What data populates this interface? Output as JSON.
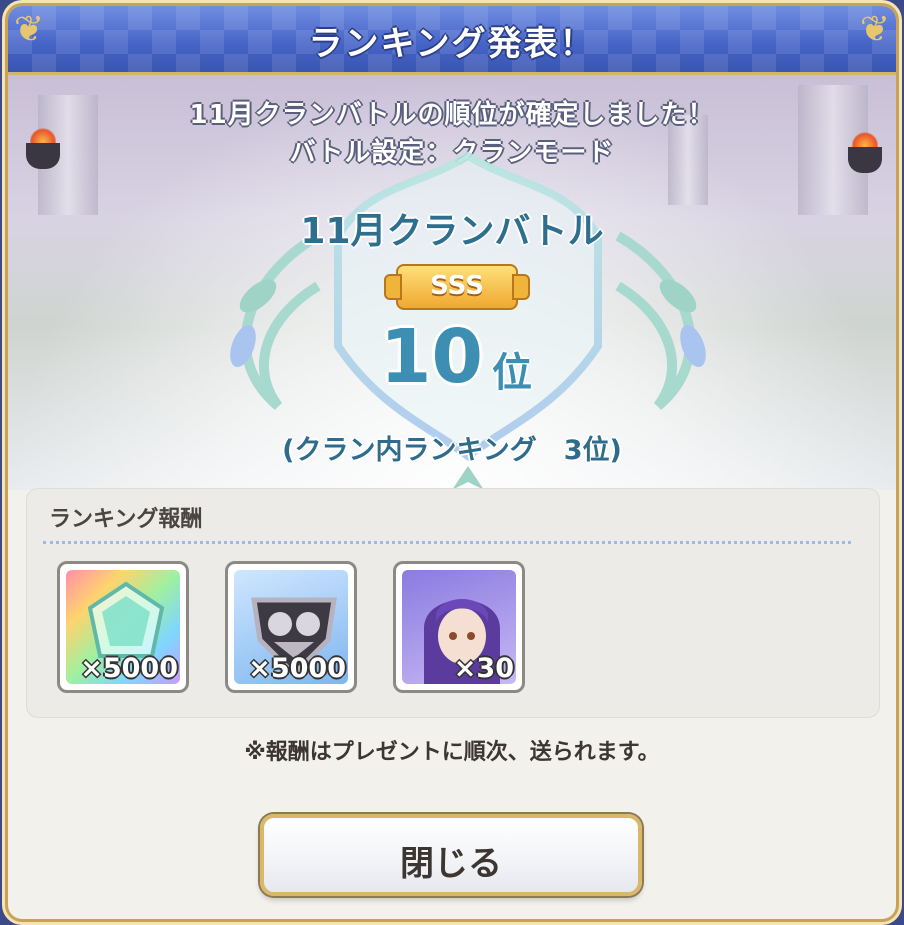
{
  "dialog": {
    "title": "ランキング発表！",
    "announcement_line1": "11月クランバトルの順位が確定しました！",
    "announcement_line2": "バトル設定：クランモード"
  },
  "result": {
    "battle_name": "11月クランバトル",
    "rank_grade": "SSS",
    "rank_number": "10",
    "rank_suffix": "位",
    "clan_internal_rank": "(クラン内ランキング　3位)"
  },
  "rewards": {
    "heading": "ランキング報酬",
    "items": [
      {
        "icon": "rainbow-jewel-icon",
        "quantity": "×5000"
      },
      {
        "icon": "clan-coin-icon",
        "quantity": "×5000"
      },
      {
        "icon": "character-memory-piece-icon",
        "quantity": "×30"
      }
    ],
    "note": "※報酬はプレゼントに順次、送られます。"
  },
  "buttons": {
    "close_label": "閉じる"
  },
  "colors": {
    "title_bar": "#4563c6",
    "gold_border": "#d6b46a",
    "rank_text": "#3c8fb3",
    "sss_badge": "#f0a830"
  }
}
